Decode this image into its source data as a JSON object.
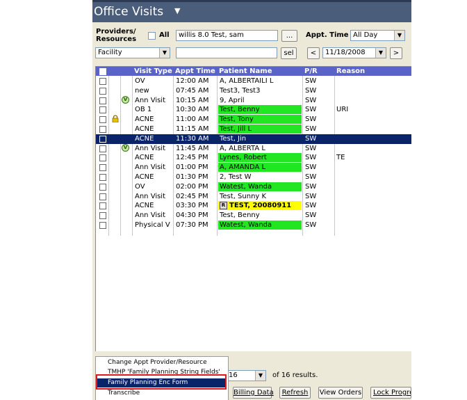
{
  "window": {
    "title": "Office Visits"
  },
  "filters": {
    "providers_label": "Providers/\nResources",
    "all_label": "All",
    "provider_value": "willis 8.0 Test, sam",
    "browse_label": "...",
    "appt_time_label": "Appt. Time",
    "appt_time_value": "All Day",
    "facility_value": "Facility",
    "facility_text": "",
    "sel_label": "sel",
    "prev_label": "<",
    "date_value": "11/18/2008",
    "next_label": ">"
  },
  "table": {
    "headers": [
      "Visit Type",
      "Appt Time",
      "Patient Name",
      "P/R",
      "Reason"
    ],
    "rows": [
      {
        "visit_type": "OV",
        "time": "12:00 AM",
        "patient": "A, ALBERTAILI L",
        "pr": "SW",
        "reason": "",
        "highlight": "none",
        "icon": ""
      },
      {
        "visit_type": "new",
        "time": "07:45 AM",
        "patient": "Test3, Test3",
        "pr": "SW",
        "reason": "",
        "highlight": "none",
        "icon": ""
      },
      {
        "visit_type": "Ann Visit",
        "time": "10:15 AM",
        "patient": "9, April",
        "pr": "SW",
        "reason": "",
        "highlight": "none",
        "icon": "visit-icon"
      },
      {
        "visit_type": "OB 1",
        "time": "10:30 AM",
        "patient": "Test, Benny",
        "pr": "SW",
        "reason": "URI",
        "highlight": "green",
        "icon": ""
      },
      {
        "visit_type": "ACNE",
        "time": "11:00 AM",
        "patient": "Test, Tony",
        "pr": "SW",
        "reason": "",
        "highlight": "green",
        "icon": "lock-icon"
      },
      {
        "visit_type": "ACNE",
        "time": "11:15 AM",
        "patient": "Test, Jill L",
        "pr": "SW",
        "reason": "",
        "highlight": "green",
        "icon": ""
      },
      {
        "visit_type": "ACNE",
        "time": "11:30 AM",
        "patient": "Test, Jin",
        "pr": "SW",
        "reason": "",
        "highlight": "none",
        "icon": "",
        "selected": true
      },
      {
        "visit_type": "Ann Visit",
        "time": "11:45 AM",
        "patient": "A, ALBERTA L",
        "pr": "SW",
        "reason": "",
        "highlight": "none",
        "icon": "visit-icon"
      },
      {
        "visit_type": "ACNE",
        "time": "12:45 PM",
        "patient": "Lynes, Robert",
        "pr": "SW",
        "reason": "TE",
        "highlight": "green",
        "icon": ""
      },
      {
        "visit_type": "Ann Visit",
        "time": "01:00 PM",
        "patient": "A, AMANDA L",
        "pr": "SW",
        "reason": "",
        "highlight": "green",
        "icon": ""
      },
      {
        "visit_type": "ACNE",
        "time": "01:30 PM",
        "patient": "2, Test W",
        "pr": "SW",
        "reason": "",
        "highlight": "none",
        "icon": ""
      },
      {
        "visit_type": "OV",
        "time": "02:00 PM",
        "patient": "Watest, Wanda",
        "pr": "SW",
        "reason": "",
        "highlight": "green",
        "icon": ""
      },
      {
        "visit_type": "Ann Visit",
        "time": "02:45 PM",
        "patient": "Test, Sunny K",
        "pr": "SW",
        "reason": "",
        "highlight": "none",
        "icon": ""
      },
      {
        "visit_type": "ACNE",
        "time": "03:30 PM",
        "patient": "TEST, 20080911",
        "pr": "SW",
        "reason": "",
        "highlight": "yellow",
        "icon": "",
        "patient_badge": "R"
      },
      {
        "visit_type": "Ann Visit",
        "time": "04:30 PM",
        "patient": "Test, Benny",
        "pr": "SW",
        "reason": "",
        "highlight": "none",
        "icon": ""
      },
      {
        "visit_type": "Physical V",
        "time": "07:30 PM",
        "patient": "Watest, Wanda",
        "pr": "SW",
        "reason": "",
        "highlight": "green",
        "icon": ""
      }
    ]
  },
  "context_menu": {
    "items": [
      "Change Appt Provider/Resource",
      "TMHP 'Family Planning String Fields'",
      "Family Planning Enc Form",
      "Transcribe"
    ]
  },
  "footer": {
    "page_size": "16",
    "results_text": "of 16 results.",
    "billing_label": "Billing Data",
    "refresh_label": "Refresh",
    "view_orders_label": "View Orders",
    "lock_progress_label": "Lock Progres"
  },
  "colors": {
    "title_bar": "#4a5d7a",
    "header": "#5a64c8",
    "selected": "#0a246a",
    "green": "#22e622",
    "yellow": "#ffff00",
    "callout": "#e0191f"
  }
}
